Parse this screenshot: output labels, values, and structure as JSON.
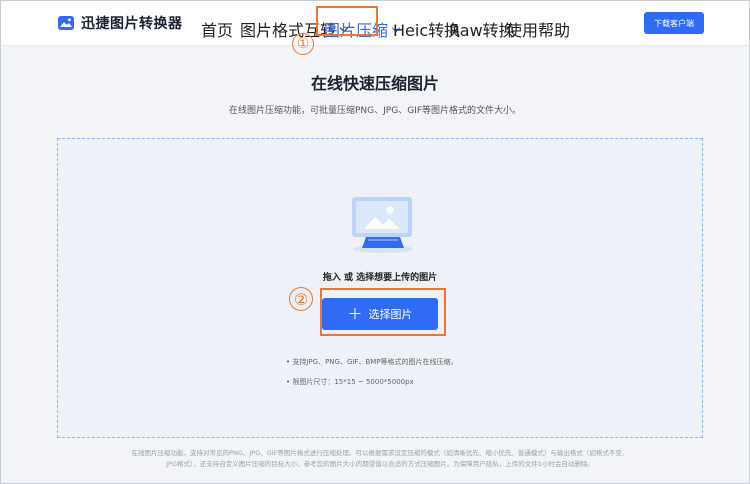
{
  "header": {
    "logo_text": "迅捷图片转换器",
    "nav": [
      {
        "label": "首页",
        "has_dropdown": false,
        "active": false
      },
      {
        "label": "图片格式互转",
        "has_dropdown": true,
        "active": false
      },
      {
        "label": "图片压缩",
        "has_dropdown": true,
        "active": true
      },
      {
        "label": "Heic转换",
        "has_dropdown": false,
        "active": false
      },
      {
        "label": "Raw转换",
        "has_dropdown": false,
        "active": false
      },
      {
        "label": "使用帮助",
        "has_dropdown": false,
        "active": false
      }
    ],
    "download_label": "下载客户端"
  },
  "annotations": {
    "step1": "①",
    "step2": "②"
  },
  "main": {
    "title": "在线快速压缩图片",
    "subtitle": "在线图片压缩功能，可批量压缩PNG、JPG、GIF等图片格式的文件大小。",
    "drop_hint": "拖入 或 选择想要上传的图片",
    "select_button_label": "选择图片",
    "notes": [
      "• 支持JPG、PNG、GIF、BMP等格式的图片在线压缩。",
      "• 限图片尺寸：15*15 ~ 5000*5000px"
    ]
  },
  "footer": {
    "line1": "在线图片压缩功能，支持对常见的PNG、JPG、GIF等图片格式进行压缩处理。可以根据需求设定压缩的模式（如清晰优先、缩小优先、普通模式）与输出格式（如格式不变、",
    "line2": "JPG格式），还支持自定义图片压缩的目标大小，参考您的图片大小的期望值以合适的方式压缩图片。为保障用户隐私，上传的文件1小时会自动删除。"
  },
  "colors": {
    "accent": "#2f6bf5",
    "annotation": "#f0762f"
  }
}
